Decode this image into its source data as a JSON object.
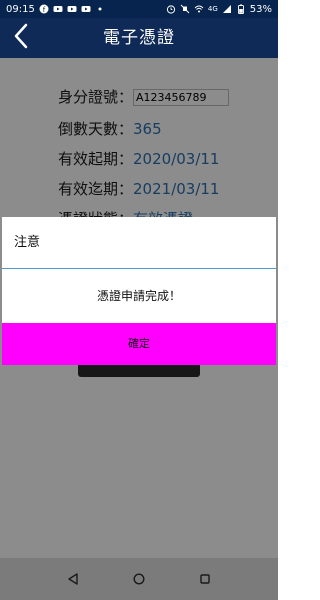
{
  "status_bar": {
    "time": "09:15",
    "network": "4G",
    "battery": "53%"
  },
  "header": {
    "title": "電子憑證"
  },
  "fields": [
    {
      "label": "身分證號：",
      "value": "A123456789"
    },
    {
      "label": "倒數天數：",
      "value": "365"
    },
    {
      "label": "有效起期：",
      "value": "2020/03/11"
    },
    {
      "label": "有效迄期：",
      "value": "2021/03/11"
    },
    {
      "label": "憑證狀態：",
      "value": "有效憑證"
    }
  ],
  "dialog": {
    "title": "注意",
    "message": "憑證申請完成！",
    "ok_label": "確定"
  },
  "colors": {
    "header_bg": "#102a57",
    "value_text": "#2b6fb0",
    "ok_button_bg": "#ff00ff",
    "divider": "#4f9bd1"
  },
  "icons": {
    "back": "chevron-left-icon",
    "nav_back": "triangle-back-icon",
    "nav_home": "circle-home-icon",
    "nav_recents": "square-recents-icon"
  }
}
